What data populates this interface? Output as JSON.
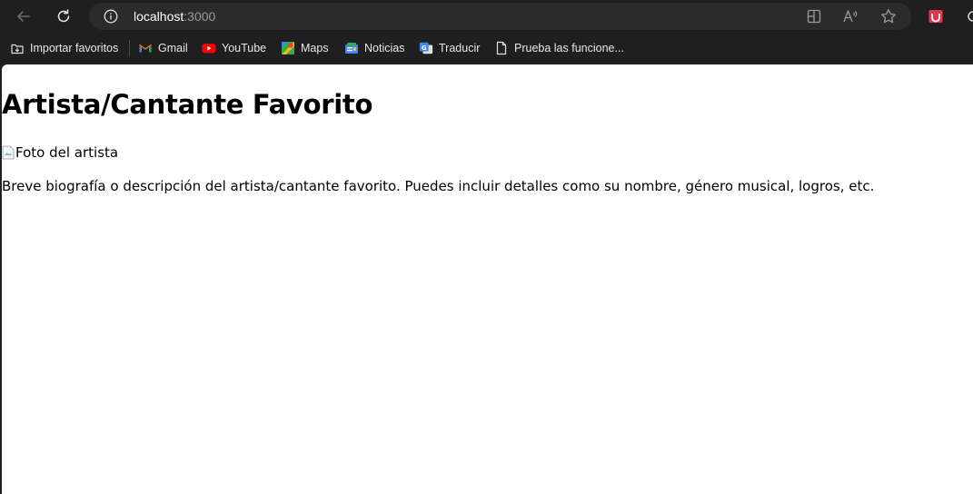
{
  "browser": {
    "address_host": "localhost",
    "address_port": ":3000",
    "icons": [
      "back-arrow-icon",
      "refresh-icon",
      "info-icon",
      "split-screen-icon",
      "read-aloud-icon",
      "favorite-star-icon",
      "extension-icon"
    ]
  },
  "bookmarks": [
    {
      "label": "Importar favoritos",
      "icon": "import-favorites-icon"
    },
    {
      "label": "Gmail",
      "icon": "gmail-icon"
    },
    {
      "label": "YouTube",
      "icon": "youtube-icon"
    },
    {
      "label": "Maps",
      "icon": "maps-icon"
    },
    {
      "label": "Noticias",
      "icon": "news-icon"
    },
    {
      "label": "Traducir",
      "icon": "translate-icon"
    },
    {
      "label": "Prueba las funcione...",
      "icon": "page-icon"
    }
  ],
  "page": {
    "title": "Artista/Cantante Favorito",
    "image_alt": "Foto del artista",
    "bio": "Breve biografía o descripción del artista/cantante favorito. Puedes incluir detalles como su nombre, género musical, logros, etc."
  },
  "colors": {
    "chrome_bg": "#1f1f1f",
    "address_bg": "#2b2b2b",
    "youtube_red": "#ff0000",
    "extension_red": "#e8334a"
  }
}
